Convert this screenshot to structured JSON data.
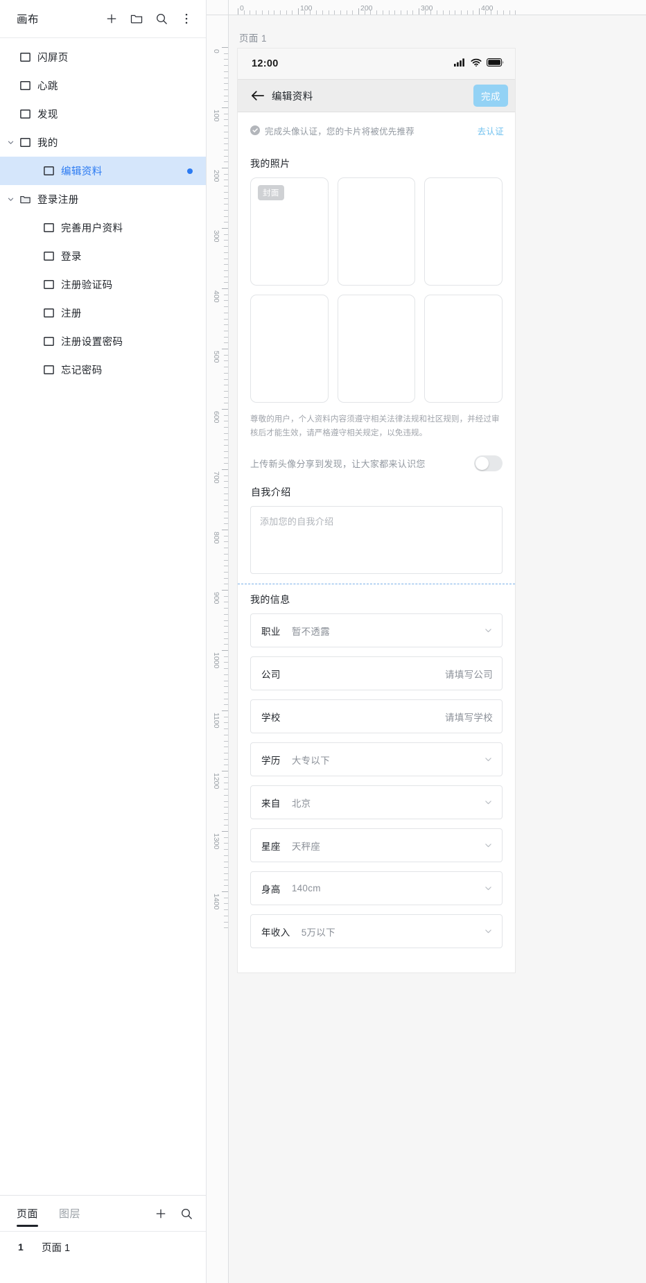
{
  "sidebar": {
    "header": {
      "title": "画布",
      "actions": [
        {
          "name": "add-page-button",
          "icon": "plus-icon"
        },
        {
          "name": "new-folder-button",
          "icon": "folder-icon"
        },
        {
          "name": "search-button",
          "icon": "search-icon"
        }
      ]
    },
    "tree": [
      {
        "label": "闪屏页",
        "indent": 0,
        "icon": "artboard-icon",
        "caret": "none",
        "selected": false,
        "dot": false
      },
      {
        "label": "心跳",
        "indent": 0,
        "icon": "artboard-icon",
        "caret": "none",
        "selected": false,
        "dot": false
      },
      {
        "label": "发现",
        "indent": 0,
        "icon": "artboard-icon",
        "caret": "none",
        "selected": false,
        "dot": false
      },
      {
        "label": "我的",
        "indent": 0,
        "icon": "artboard-icon",
        "caret": "expanded",
        "selected": false,
        "dot": false
      },
      {
        "label": "编辑资料",
        "indent": 1,
        "icon": "artboard-icon",
        "caret": "none",
        "selected": true,
        "dot": true
      },
      {
        "label": "登录注册",
        "indent": 0,
        "icon": "folder-icon",
        "caret": "expanded",
        "selected": false,
        "dot": false
      },
      {
        "label": "完善用户资料",
        "indent": 1,
        "icon": "artboard-icon",
        "caret": "none",
        "selected": false,
        "dot": false
      },
      {
        "label": "登录",
        "indent": 1,
        "icon": "artboard-icon",
        "caret": "none",
        "selected": false,
        "dot": false
      },
      {
        "label": "注册验证码",
        "indent": 1,
        "icon": "artboard-icon",
        "caret": "none",
        "selected": false,
        "dot": false
      },
      {
        "label": "注册",
        "indent": 1,
        "icon": "artboard-icon",
        "caret": "none",
        "selected": false,
        "dot": false
      },
      {
        "label": "注册设置密码",
        "indent": 1,
        "icon": "artboard-icon",
        "caret": "none",
        "selected": false,
        "dot": false
      },
      {
        "label": "忘记密码",
        "indent": 1,
        "icon": "artboard-icon",
        "caret": "none",
        "selected": false,
        "dot": false
      }
    ],
    "bottom": {
      "tabs": [
        {
          "label": "页面",
          "active": true
        },
        {
          "label": "图层",
          "active": false
        }
      ],
      "actions": [
        {
          "name": "add-page-button",
          "icon": "plus-icon"
        },
        {
          "name": "search-page-button",
          "icon": "search-icon"
        }
      ],
      "pages": [
        {
          "num": "1",
          "label": "页面 1"
        }
      ]
    }
  },
  "canvas": {
    "ruler": {
      "top_labels": [
        "0",
        "100",
        "200",
        "300",
        "400"
      ],
      "left_labels": [
        "0",
        "100",
        "200",
        "300",
        "400",
        "500",
        "600",
        "700",
        "800",
        "900",
        "1000",
        "1100",
        "1200",
        "1300",
        "1400"
      ],
      "unit_step": 100
    },
    "artboard_name": "页面 1"
  },
  "screen": {
    "status_bar": {
      "time": "12:00",
      "icons": [
        "cellular-signal-icon",
        "wifi-icon",
        "battery-icon"
      ]
    },
    "navbar": {
      "back_icon": "arrow-left-icon",
      "title": "编辑资料",
      "done_label": "完成",
      "done_color": "#93d2f5"
    },
    "verify_banner": {
      "icon": "check-circle-icon",
      "text": "完成头像认证，您的卡片将被优先推荐",
      "link": "去认证",
      "link_color": "#6fc0ef"
    },
    "photos": {
      "title": "我的照片",
      "cells": [
        {
          "badge": "封面"
        },
        {
          "badge": ""
        },
        {
          "badge": ""
        },
        {
          "badge": ""
        },
        {
          "badge": ""
        },
        {
          "badge": ""
        }
      ],
      "disclaimer": "尊敬的用户，个人资料内容须遵守相关法律法规和社区规则，并经过审核后才能生效，请严格遵守相关规定，以免违规。"
    },
    "share_toggle": {
      "label": "上传新头像分享到发现，让大家都来认识您",
      "checked": false
    },
    "intro": {
      "label": "自我介绍",
      "placeholder": "添加您的自我介绍",
      "value": ""
    },
    "my_info": {
      "title": "我的信息",
      "rows": [
        {
          "label": "职业",
          "value": "暂不透露",
          "align": "left",
          "chevron": true
        },
        {
          "label": "公司",
          "value": "请填写公司",
          "align": "right",
          "chevron": false
        },
        {
          "label": "学校",
          "value": "请填写学校",
          "align": "right",
          "chevron": false
        },
        {
          "label": "学历",
          "value": "大专以下",
          "align": "left",
          "chevron": true
        },
        {
          "label": "来自",
          "value": "北京",
          "align": "left",
          "chevron": true
        },
        {
          "label": "星座",
          "value": "天秤座",
          "align": "left",
          "chevron": true
        },
        {
          "label": "身高",
          "value": "140cm",
          "align": "left",
          "chevron": true
        },
        {
          "label": "年收入",
          "value": "5万以下",
          "align": "left",
          "chevron": true
        }
      ]
    }
  }
}
